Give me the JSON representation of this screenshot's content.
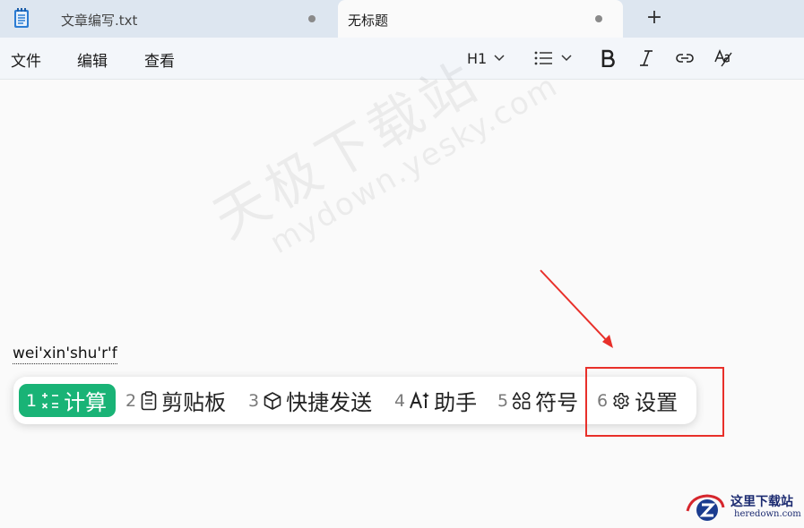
{
  "tabs": [
    {
      "title": "文章编写.txt",
      "unsaved": true
    },
    {
      "title": "无标题",
      "unsaved": true,
      "active": true
    }
  ],
  "new_tab_label": "+",
  "menu": {
    "file": "文件",
    "edit": "编辑",
    "view": "查看"
  },
  "toolbar": {
    "heading_label": "H1"
  },
  "editor": {
    "composition_text": "wei'xin'shu'r'f"
  },
  "watermark": {
    "line1": "天极下载站",
    "line2": "mydown.yesky.com"
  },
  "candidates": [
    {
      "num": "1",
      "label": "计算",
      "icon": "calculator-icon",
      "selected": true
    },
    {
      "num": "2",
      "label": "剪贴板",
      "icon": "clipboard-icon"
    },
    {
      "num": "3",
      "label": "快捷发送",
      "icon": "cube-icon"
    },
    {
      "num": "4",
      "label": "助手",
      "icon": "ai-icon"
    },
    {
      "num": "5",
      "label": "符号",
      "icon": "symbols-icon"
    },
    {
      "num": "6",
      "label": "设置",
      "icon": "gear-icon"
    }
  ],
  "logo": {
    "name": "这里下载站",
    "url_text": "heredown.com"
  },
  "colors": {
    "accent_green": "#19b376",
    "annotation_red": "#e8302a",
    "tab_bar": "#dde6f0"
  }
}
